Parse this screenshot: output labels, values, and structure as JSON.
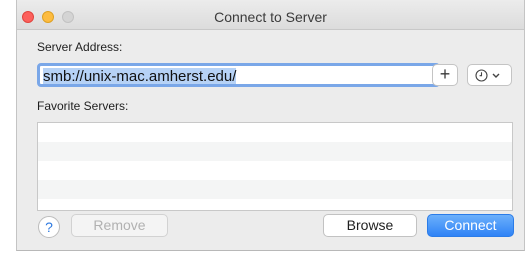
{
  "window": {
    "title": "Connect to Server"
  },
  "server_address": {
    "label": "Server Address:",
    "value": "smb://unix-mac.amherst.edu/",
    "add_button_label": "+"
  },
  "favorites": {
    "label": "Favorite Servers:",
    "items": []
  },
  "buttons": {
    "help_label": "?",
    "remove_label": "Remove",
    "browse_label": "Browse",
    "connect_label": "Connect"
  },
  "icons": {
    "history": "clock-icon",
    "dropdown": "chevron-down-icon"
  },
  "colors": {
    "accent": "#2f83f6",
    "close": "#fc605c",
    "minimize": "#fdbc40"
  }
}
